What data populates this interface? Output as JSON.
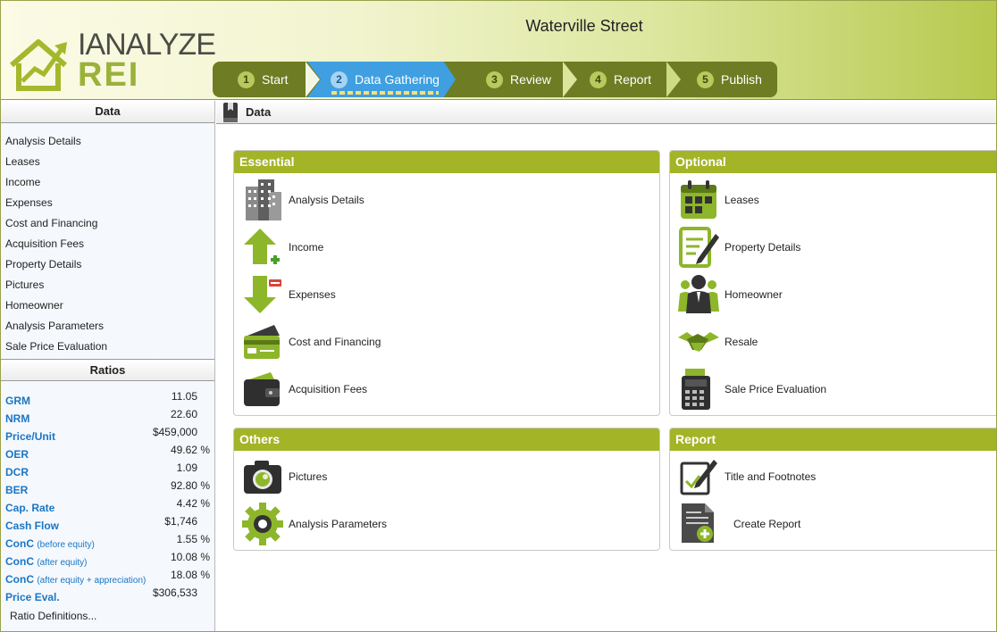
{
  "header": {
    "logo_line1": "IANALYZE",
    "logo_line2": "REI",
    "project_title": "Waterville Street"
  },
  "wizard": {
    "steps": [
      {
        "num": "1",
        "label": "Start"
      },
      {
        "num": "2",
        "label": "Data Gathering"
      },
      {
        "num": "3",
        "label": "Review"
      },
      {
        "num": "4",
        "label": "Report"
      },
      {
        "num": "5",
        "label": "Publish"
      }
    ],
    "active_step": 2
  },
  "sidebar": {
    "data_title": "Data",
    "items": [
      "Analysis Details",
      "Leases",
      "Income",
      "Expenses",
      "Cost and Financing",
      "Acquisition Fees",
      "Property Details",
      "Pictures",
      "Homeowner",
      "Analysis Parameters",
      "Sale Price Evaluation"
    ],
    "ratios_title": "Ratios",
    "ratios": [
      {
        "name": "GRM",
        "qualifier": "",
        "value": "11.05"
      },
      {
        "name": "NRM",
        "qualifier": "",
        "value": "22.60"
      },
      {
        "name": "Price/Unit",
        "qualifier": "",
        "value": "$459,000"
      },
      {
        "name": "OER",
        "qualifier": "",
        "value": "49.62 %"
      },
      {
        "name": "DCR",
        "qualifier": "",
        "value": "1.09"
      },
      {
        "name": "BER",
        "qualifier": "",
        "value": "92.80 %"
      },
      {
        "name": "Cap. Rate",
        "qualifier": "",
        "value": "4.42 %"
      },
      {
        "name": "Cash Flow",
        "qualifier": "",
        "value": "$1,746"
      },
      {
        "name": "ConC",
        "qualifier": "(before equity)",
        "value": "1.55 %"
      },
      {
        "name": "ConC",
        "qualifier": "(after equity)",
        "value": "10.08 %"
      },
      {
        "name": "ConC",
        "qualifier": "(after equity + appreciation)",
        "value": "18.08 %"
      },
      {
        "name": "Price Eval.",
        "qualifier": "",
        "value": "$306,533"
      }
    ],
    "ratio_definitions_link": "Ratio Definitions..."
  },
  "content": {
    "title": "Data",
    "panels": {
      "essential": {
        "title": "Essential",
        "items": [
          {
            "label": "Analysis Details",
            "icon": "building-icon"
          },
          {
            "label": "Income",
            "icon": "income-arrow-icon"
          },
          {
            "label": "Expenses",
            "icon": "expense-arrow-icon"
          },
          {
            "label": "Cost and Financing",
            "icon": "credit-card-icon"
          },
          {
            "label": "Acquisition Fees",
            "icon": "wallet-icon"
          }
        ]
      },
      "optional": {
        "title": "Optional",
        "items": [
          {
            "label": "Leases",
            "icon": "calendar-icon"
          },
          {
            "label": "Property Details",
            "icon": "notepad-pen-icon"
          },
          {
            "label": "Homeowner",
            "icon": "people-icon"
          },
          {
            "label": "Resale",
            "icon": "handshake-icon"
          },
          {
            "label": "Sale Price Evaluation",
            "icon": "calculator-icon"
          }
        ]
      },
      "others": {
        "title": "Others",
        "items": [
          {
            "label": "Pictures",
            "icon": "camera-icon"
          },
          {
            "label": "Analysis Parameters",
            "icon": "gear-icon"
          }
        ]
      },
      "report": {
        "title": "Report",
        "items": [
          {
            "label": "Title and Footnotes",
            "icon": "edit-note-icon"
          },
          {
            "label": "Create Report",
            "icon": "add-document-icon"
          }
        ]
      }
    }
  },
  "colors": {
    "accent": "#a3b426",
    "wizard_bg": "#6e7c23",
    "active_step": "#3f9fe0",
    "ratio_label": "#1a76c4"
  }
}
